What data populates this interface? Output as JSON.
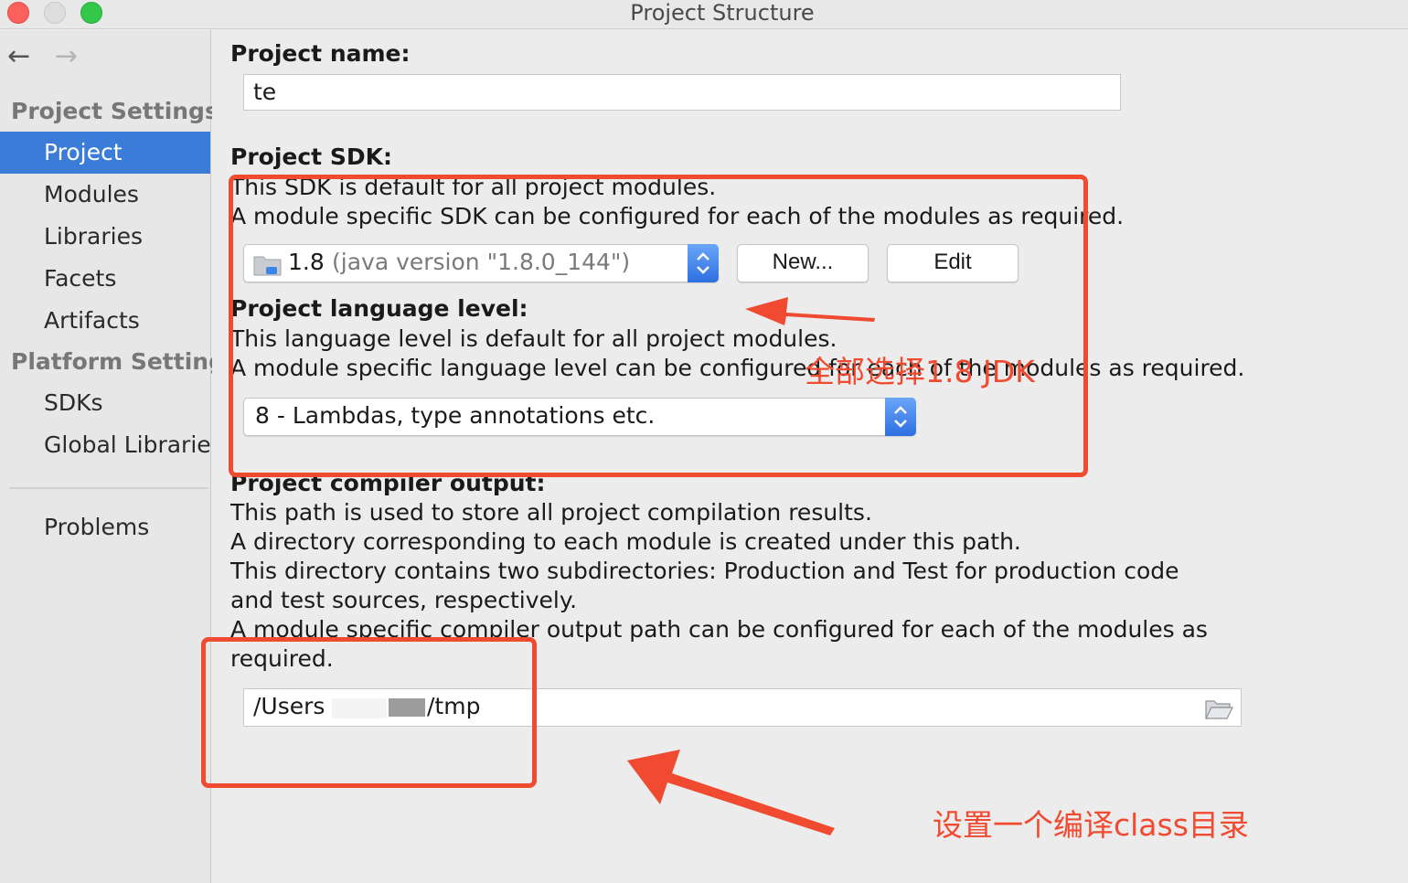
{
  "window": {
    "title": "Project Structure"
  },
  "sidebar": {
    "back_glyph": "←",
    "forward_glyph": "→",
    "section_project_settings": "Project Settings",
    "section_platform_settings": "Platform Setting",
    "items": [
      {
        "label": "Project",
        "selected": true
      },
      {
        "label": "Modules"
      },
      {
        "label": "Libraries"
      },
      {
        "label": "Facets"
      },
      {
        "label": "Artifacts"
      },
      {
        "label": "SDKs"
      },
      {
        "label": "Global Librarie"
      },
      {
        "label": "Problems"
      }
    ]
  },
  "project_name": {
    "label": "Project name:",
    "value": "te"
  },
  "sdk": {
    "label": "Project SDK:",
    "desc1": "This SDK is default for all project modules.",
    "desc2": "A module specific SDK can be configured for each of the modules as required.",
    "selected_version": "1.8",
    "selected_detail": "(java version \"1.8.0_144\")",
    "new_button": "New...",
    "edit_button": "Edit"
  },
  "language_level": {
    "label": "Project language level:",
    "desc1": "This language level is default for all project modules.",
    "desc2": "A module specific language level can be configured for each of the modules as required.",
    "selected": "8 - Lambdas, type annotations etc."
  },
  "compiler_output": {
    "label": "Project compiler output:",
    "desc1": "This path is used to store all project compilation results.",
    "desc2": "A directory corresponding to each module is created under this path.",
    "desc3": "This directory contains two subdirectories: Production and Test for production code",
    "desc4": "and test sources, respectively.",
    "desc5": "A module specific compiler output path can be configured for each of the modules as",
    "desc6": "required.",
    "path_prefix": "/Users",
    "path_suffix": "/tmp"
  },
  "annotations": {
    "sdk_note": "全部选择1.8 JDK",
    "output_note": "设置一个编译class目录",
    "color": "#f04a30"
  },
  "icons": {
    "folder": "folder-icon",
    "browse": "folder-open-icon",
    "combo": "chevron-updown-icon"
  }
}
